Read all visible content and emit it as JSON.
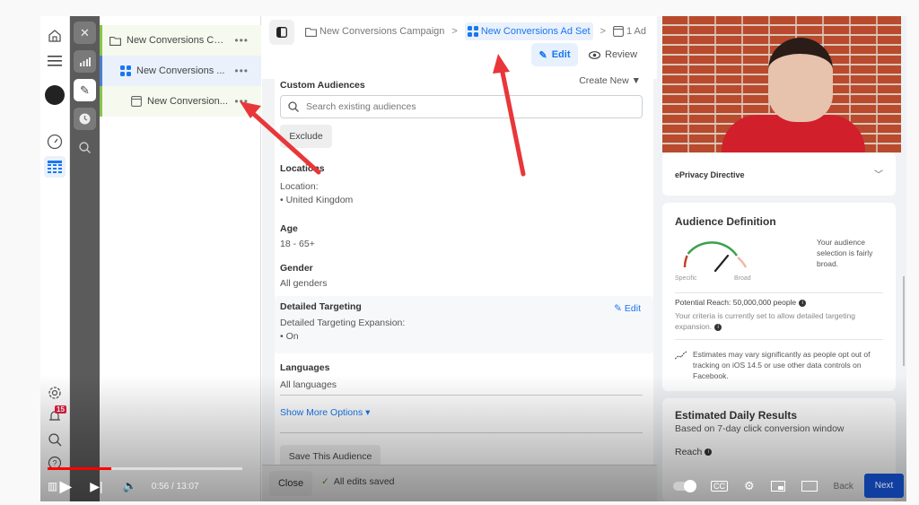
{
  "rail": {
    "items": [
      {
        "icon": "home-icon"
      },
      {
        "icon": "menu-icon"
      },
      {
        "icon": "avatar"
      },
      {
        "icon": "dashboard-gauge-icon"
      },
      {
        "icon": "table-grid-icon",
        "selected": true
      }
    ],
    "bottom": [
      {
        "icon": "settings-icon"
      },
      {
        "icon": "notifications-bell-icon",
        "badge": "15"
      },
      {
        "icon": "search-icon"
      },
      {
        "icon": "help-icon"
      }
    ]
  },
  "strip": {
    "items": [
      "close-icon",
      "chart-icon",
      "edit-pencil-icon",
      "clock-icon",
      "search-chart-icon"
    ]
  },
  "tree": {
    "items": [
      {
        "label": "New Conversions Ca...",
        "type": "campaign"
      },
      {
        "label": "New Conversions ...",
        "type": "ad-set"
      },
      {
        "label": "New Conversion...",
        "type": "ad"
      }
    ],
    "more": "•••"
  },
  "breadcrumb": {
    "campaign": "New Conversions Campaign",
    "adset": "New Conversions Ad Set",
    "ad": "1 Ad",
    "separator": ">"
  },
  "mode": {
    "edit": "Edit",
    "review": "Review"
  },
  "form": {
    "custom_audiences": "Custom Audiences",
    "create_new": "Create New",
    "search_placeholder": "Search existing audiences",
    "exclude": "Exclude",
    "locations_title": "Locations",
    "location_label": "Location:",
    "location_value": "• United Kingdom",
    "age_title": "Age",
    "age_value": "18 - 65+",
    "gender_title": "Gender",
    "gender_value": "All genders",
    "dt_title": "Detailed Targeting",
    "dt_edit": "Edit",
    "dt_expansion_label": "Detailed Targeting Expansion:",
    "dt_expansion_value": "• On",
    "languages_title": "Languages",
    "languages_value": "All languages",
    "show_more": "Show More Options ▾",
    "save_audience": "Save This Audience"
  },
  "footer": {
    "close": "Close",
    "status": "All edits saved"
  },
  "right": {
    "privacy": "ePrivacy Directive",
    "audience_title": "Audience Definition",
    "gauge_left": "Specific",
    "gauge_right": "Broad",
    "gauge_level": 0.72,
    "audience_desc": "Your audience selection is fairly broad.",
    "potential_reach": "Potential Reach: 50,000,000 people",
    "criteria": "Your criteria is currently set to allow detailed targeting expansion.",
    "estimates_note": "Estimates may vary significantly as people opt out of tracking on iOS 14.5 or use other data controls on Facebook.",
    "daily_title": "Estimated Daily Results",
    "daily_sub": "Based on 7-day click conversion window",
    "reach_label": "Reach"
  },
  "player": {
    "time": "0:56 / 13:07",
    "progress": 0.071,
    "back": "Back",
    "next": "Next"
  },
  "colors": {
    "accent": "#1877f2",
    "progress": "#ff0000",
    "annotation_arrow": "#e8373a"
  }
}
